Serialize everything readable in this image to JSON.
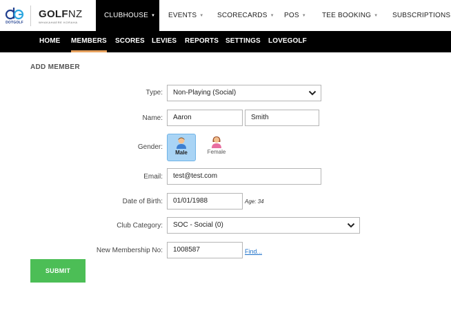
{
  "brand": {
    "dotgolf_text": "DOTGOLF",
    "golfnz_bold": "GOLF",
    "golfnz_light": "NZ",
    "golfnz_tagline": "WHAKAHAERE KORAHA"
  },
  "top_nav": [
    {
      "label": "CLUBHOUSE",
      "active": true,
      "dropdown": true
    },
    {
      "label": "EVENTS",
      "active": false,
      "dropdown": true
    },
    {
      "label": "SCORECARDS",
      "active": false,
      "dropdown": true
    },
    {
      "label": "POS",
      "active": false,
      "dropdown": true
    },
    {
      "label": "TEE BOOKING",
      "active": false,
      "dropdown": true
    },
    {
      "label": "SUBSCRIPTIONS",
      "active": false,
      "dropdown": false
    }
  ],
  "sub_nav": [
    {
      "label": "HOME",
      "active": false
    },
    {
      "label": "MEMBERS",
      "active": true
    },
    {
      "label": "SCORES",
      "active": false
    },
    {
      "label": "LEVIES",
      "active": false
    },
    {
      "label": "REPORTS",
      "active": false
    },
    {
      "label": "SETTINGS",
      "active": false
    },
    {
      "label": "LOVEGOLF",
      "active": false
    }
  ],
  "page_title": "ADD MEMBER",
  "form": {
    "type": {
      "label": "Type:",
      "value": "Non-Playing (Social)"
    },
    "name": {
      "label": "Name:",
      "first": "Aaron",
      "last": "Smith"
    },
    "gender": {
      "label": "Gender:",
      "male": "Male",
      "female": "Female",
      "selected": "Male"
    },
    "email": {
      "label": "Email:",
      "value": "test@test.com"
    },
    "dob": {
      "label": "Date of Birth:",
      "value": "01/01/1988",
      "age_text": "Age: 34"
    },
    "club_category": {
      "label": "Club Category:",
      "value": "SOC - Social (0)"
    },
    "membership_no": {
      "label": "New Membership No:",
      "value": "1008587",
      "find_link": "Find..."
    }
  },
  "submit_label": "SUBMIT",
  "colors": {
    "active_top_nav_bg": "#000000",
    "sub_nav_bg": "#000000",
    "sub_nav_active_underline": "#e8a25f",
    "submit_bg": "#4cbe56",
    "gender_selected_bg": "#a9d4f5",
    "link": "#1a6fc9"
  }
}
